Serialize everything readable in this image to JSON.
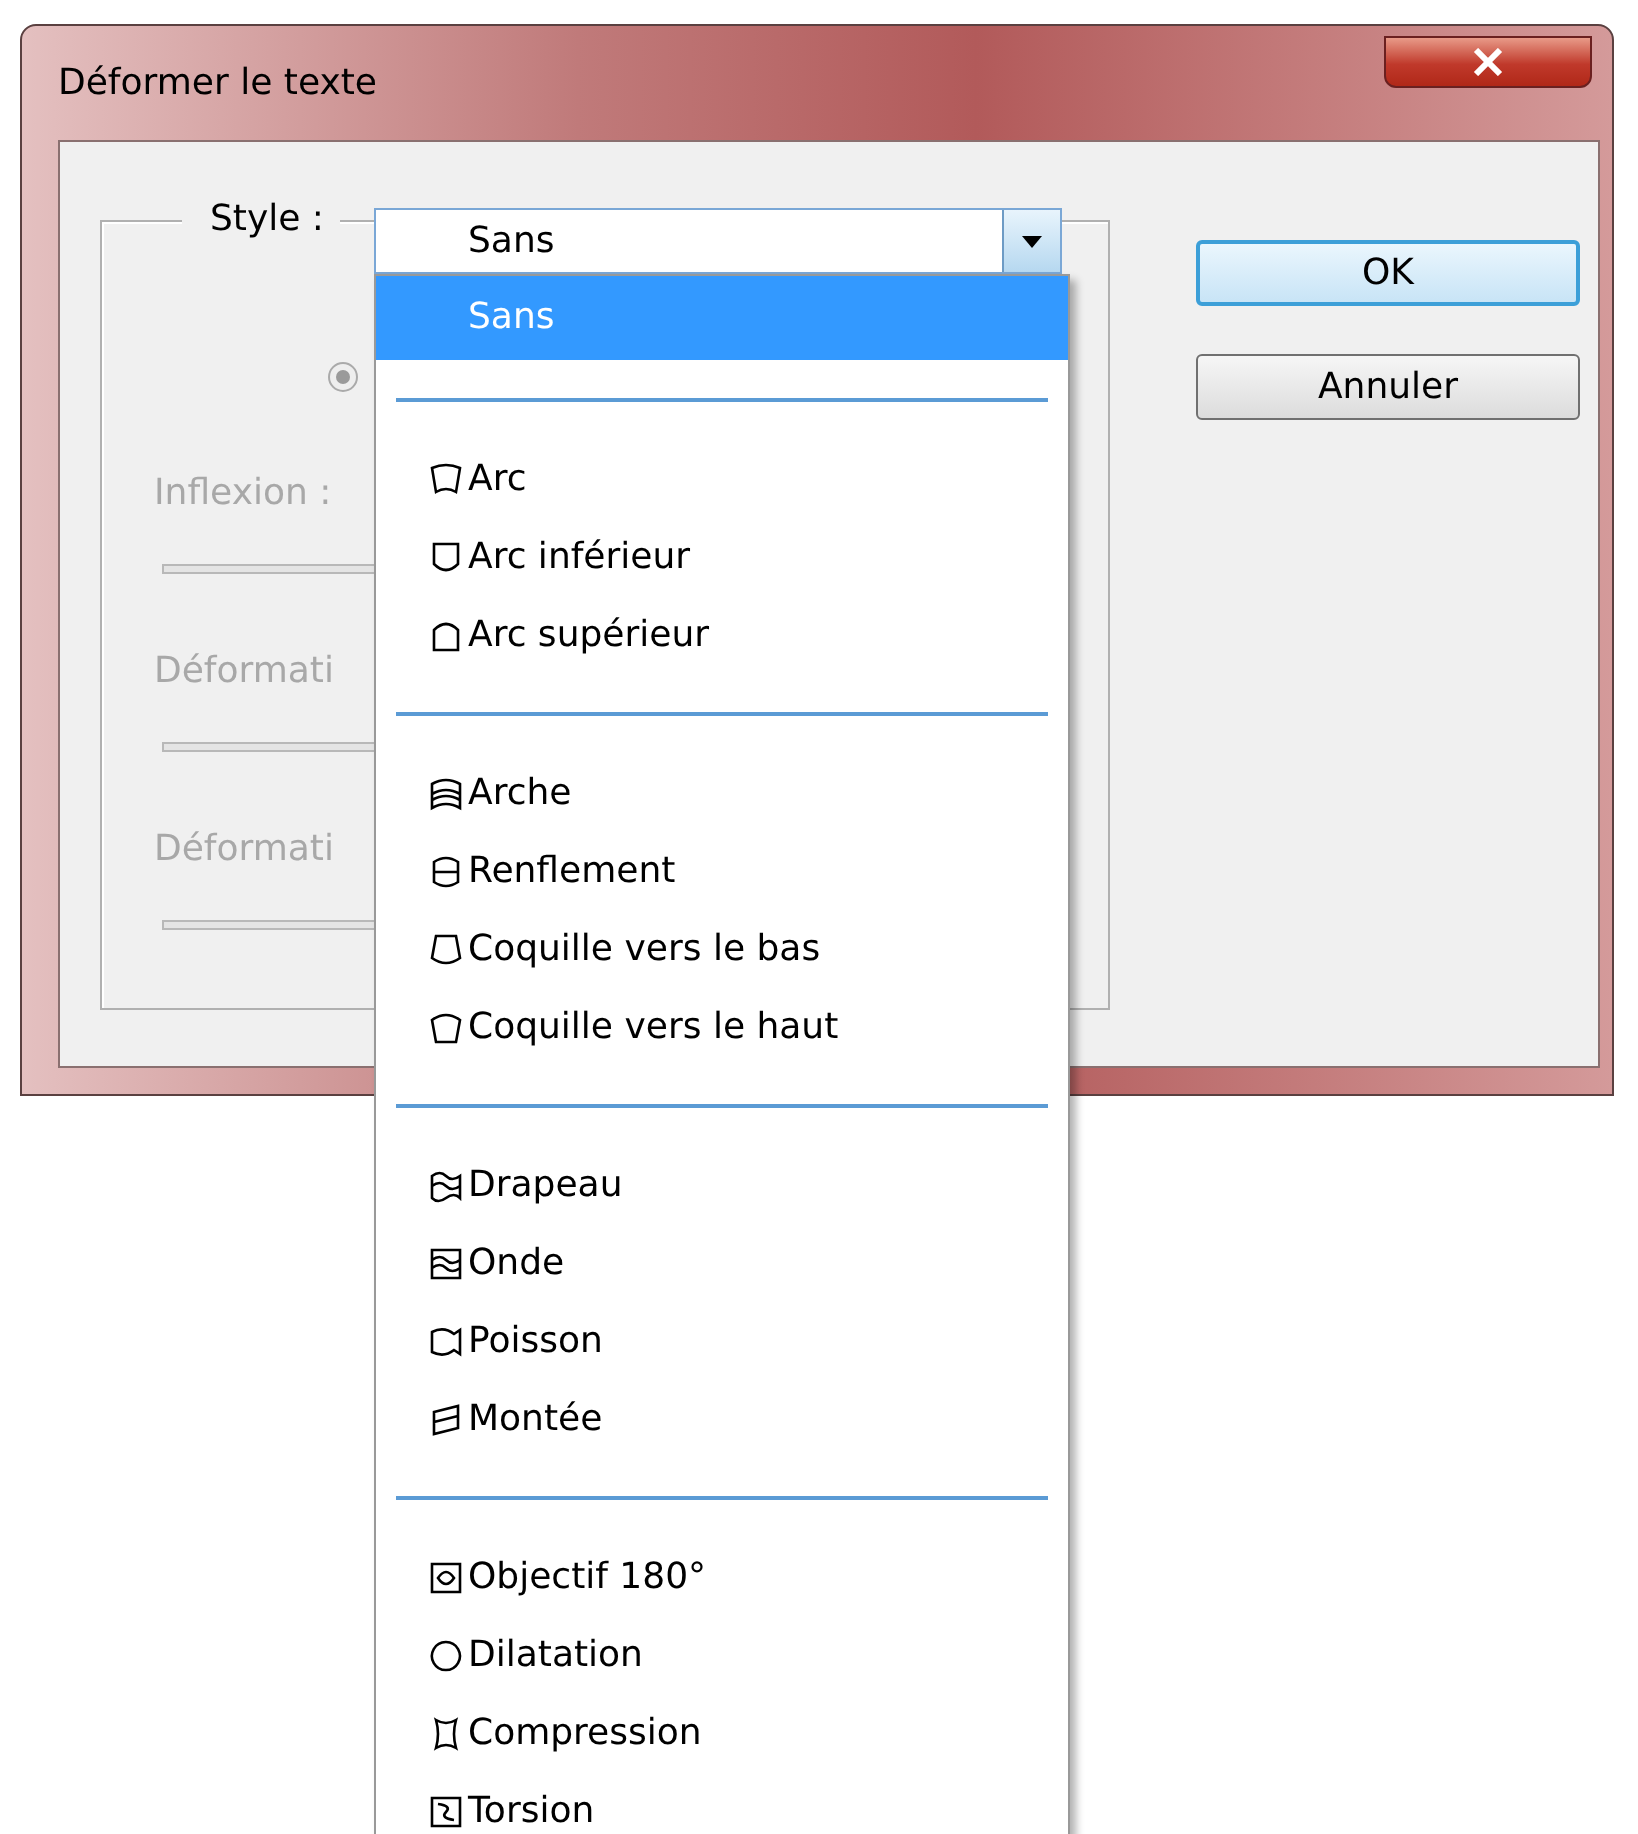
{
  "window": {
    "title": "Déformer le texte"
  },
  "style_field": {
    "label": "Style :",
    "value": "Sans"
  },
  "radio_button": {
    "selected": true,
    "disabled": true
  },
  "sliders": [
    {
      "label": "Inflexion :",
      "disabled": true
    },
    {
      "label": "Déformati",
      "disabled": true
    },
    {
      "label": "Déformati",
      "disabled": true
    }
  ],
  "buttons": [
    {
      "label": "OK",
      "focused": true
    },
    {
      "label": "Annuler",
      "focused": false
    }
  ],
  "dropdown": {
    "top_item": {
      "label": "Sans",
      "selected": true
    },
    "groups": [
      {
        "items": [
          {
            "label": "Arc",
            "selected": false
          },
          {
            "label": "Arc inférieur",
            "selected": false
          },
          {
            "label": "Arc supérieur",
            "selected": false
          }
        ]
      },
      {
        "items": [
          {
            "label": "Arche",
            "selected": false
          },
          {
            "label": "Renflement",
            "selected": false
          },
          {
            "label": "Coquille vers le bas",
            "selected": false
          },
          {
            "label": "Coquille vers le haut",
            "selected": false
          }
        ]
      },
      {
        "items": [
          {
            "label": "Drapeau",
            "selected": false
          },
          {
            "label": "Onde",
            "selected": false
          },
          {
            "label": "Poisson",
            "selected": false
          },
          {
            "label": "Montée",
            "selected": false
          }
        ]
      },
      {
        "items": [
          {
            "label": "Objectif 180°",
            "selected": false
          },
          {
            "label": "Dilatation",
            "selected": false
          },
          {
            "label": "Compression",
            "selected": false
          },
          {
            "label": "Torsion",
            "selected": false
          }
        ]
      }
    ]
  }
}
